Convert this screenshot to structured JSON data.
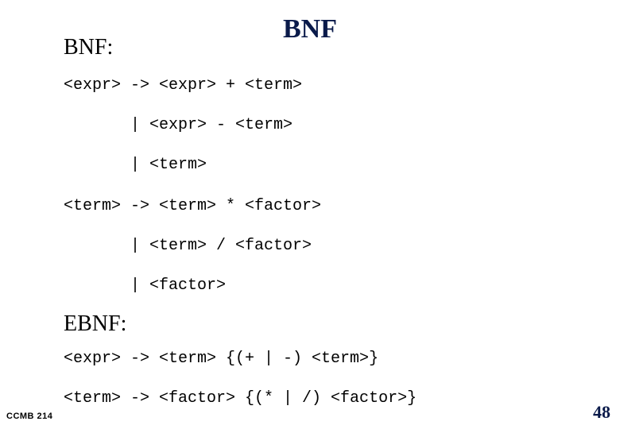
{
  "title": "BNF",
  "section1_heading": "BNF:",
  "section2_heading": "EBNF:",
  "bnf_lines": {
    "l1": "<expr> -> <expr> + <term>",
    "l2": "       | <expr> - <term>",
    "l3": "       | <term>",
    "l4": "<term> -> <term> * <factor>",
    "l5": "       | <term> / <factor>",
    "l6": "       | <factor>"
  },
  "ebnf_lines": {
    "l1": "<expr> -> <term> {(+ | -) <term>}",
    "l2": "<term> -> <factor> {(* | /) <factor>}"
  },
  "footer": {
    "course": "CCMB 214",
    "page": "48"
  }
}
